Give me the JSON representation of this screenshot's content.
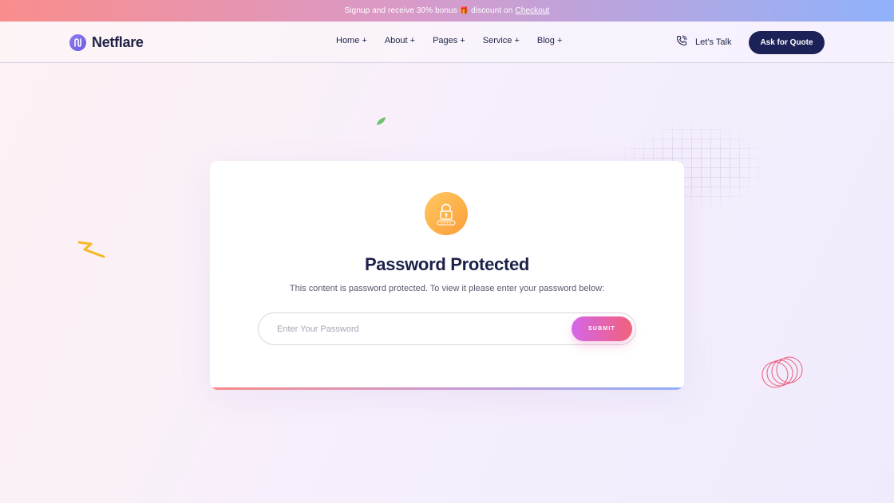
{
  "announcement": {
    "text": "Signup and receive 30% bonus",
    "gift_icon": "🎁",
    "discount_text": "discount on",
    "link_label": "Checkout"
  },
  "header": {
    "logo_text": "Netflare",
    "nav": [
      {
        "label": "Home +"
      },
      {
        "label": "About +"
      },
      {
        "label": "Pages +"
      },
      {
        "label": "Service +"
      },
      {
        "label": "Blog +"
      }
    ],
    "talk_label": "Let’s Talk",
    "quote_button": "Ask for Quote"
  },
  "card": {
    "title": "Password Protected",
    "subtitle": "This content is password protected. To view it please enter your password below:",
    "password_placeholder": "Enter Your Password",
    "password_value": "",
    "submit_label": "SUBMIT"
  },
  "icons": {
    "logo": "netflare-logo-icon",
    "phone": "phone-icon",
    "lock": "lock-icon",
    "gift": "gift-icon"
  },
  "colors": {
    "primary_dark": "#1c2258",
    "accent_gradient_start": "#d466e8",
    "accent_gradient_end": "#f2627a",
    "lock_badge": "#fbb04a"
  }
}
